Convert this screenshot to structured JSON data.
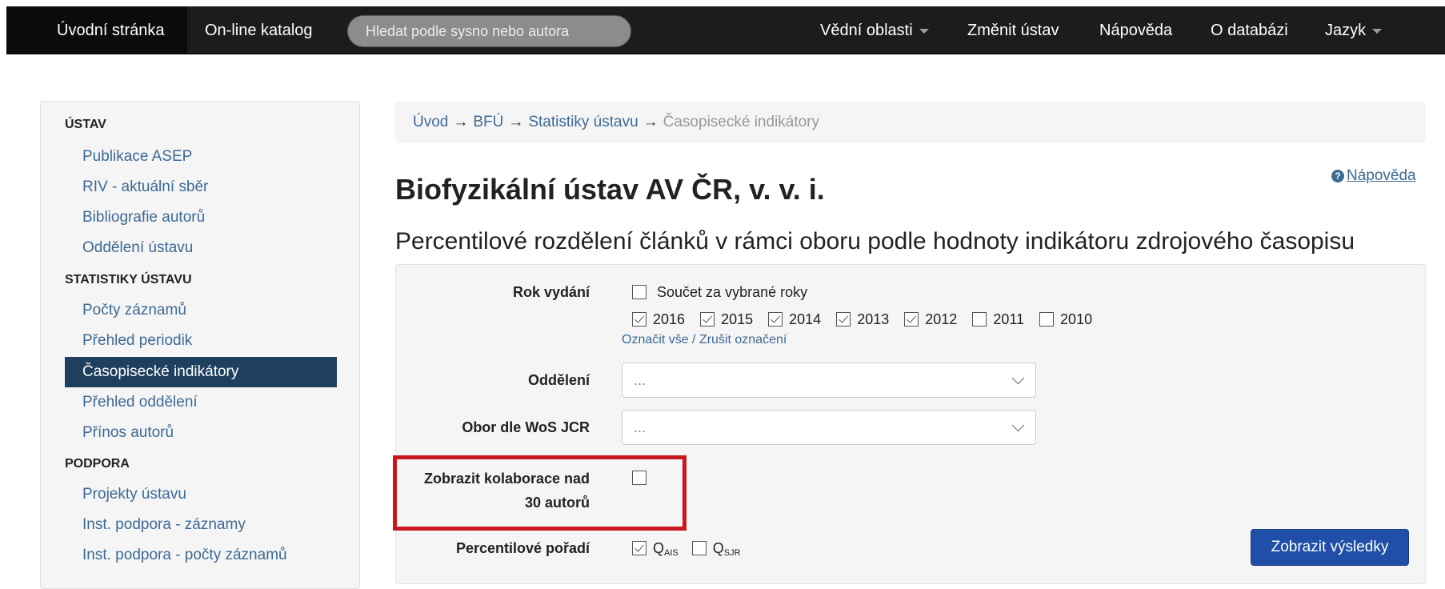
{
  "navbar": {
    "items": [
      "Úvodní stránka",
      "On-line katalog"
    ],
    "search_placeholder": "Hledat podle sysno nebo autora",
    "right_items": [
      "Vědní oblasti",
      "Změnit ústav",
      "Nápověda",
      "O databázi",
      "Jazyk"
    ]
  },
  "sidebar": {
    "sections": [
      {
        "header": "ÚSTAV",
        "items": [
          "Publikace ASEP",
          "RIV - aktuální sběr",
          "Bibliografie autorů",
          "Oddělení ústavu"
        ]
      },
      {
        "header": "STATISTIKY ÚSTAVU",
        "items": [
          "Počty záznamů",
          "Přehled periodik",
          "Časopisecké indikátory",
          "Přehled oddělení",
          "Přínos autorů"
        ]
      },
      {
        "header": "PODPORA",
        "items": [
          "Projekty ústavu",
          "Inst. podpora - záznamy",
          "Inst. podpora - počty záznamů"
        ]
      }
    ],
    "active_item": "Časopisecké indikátory"
  },
  "breadcrumb": {
    "items": [
      "Úvod",
      "BFÚ",
      "Statistiky ústavu"
    ],
    "separator": "→",
    "current": "Časopisecké indikátory"
  },
  "help_link": "Nápověda",
  "page_title": "Biofyzikální ústav AV ČR, v. v. i.",
  "section_title": "Percentilové rozdělení článků v rámci oboru podle hodnoty indikátoru zdrojového časopisu",
  "form": {
    "year_label": "Rok vydání",
    "sum_label": "Součet za vybrané roky",
    "sum_checked": false,
    "years": [
      {
        "label": "2016",
        "checked": true
      },
      {
        "label": "2015",
        "checked": true
      },
      {
        "label": "2014",
        "checked": true
      },
      {
        "label": "2013",
        "checked": true
      },
      {
        "label": "2012",
        "checked": true
      },
      {
        "label": "2011",
        "checked": false
      },
      {
        "label": "2010",
        "checked": false
      }
    ],
    "select_all": "Označit vše",
    "link_separator": " / ",
    "deselect_all": "Zrušit označení",
    "department_label": "Oddělení",
    "department_value": "...",
    "field_label": "Obor dle WoS JCR",
    "field_value": "...",
    "collab_label_line1": "Zobrazit kolaborace nad",
    "collab_label_line2": "30 autorů",
    "collab_checked": false,
    "percentile_label": "Percentilové pořadí",
    "q_ais": {
      "main": "Q",
      "sub": "AIS",
      "checked": true
    },
    "q_sjr": {
      "main": "Q",
      "sub": "SJR",
      "checked": false
    },
    "submit_label": "Zobrazit výsledky"
  },
  "colors": {
    "navbar_bg": "#1c1c1c",
    "link": "#3d6a94",
    "sidebar_active_bg": "#1e3f5e",
    "primary_button": "#1f4fa6",
    "highlight": "#c8161d"
  }
}
